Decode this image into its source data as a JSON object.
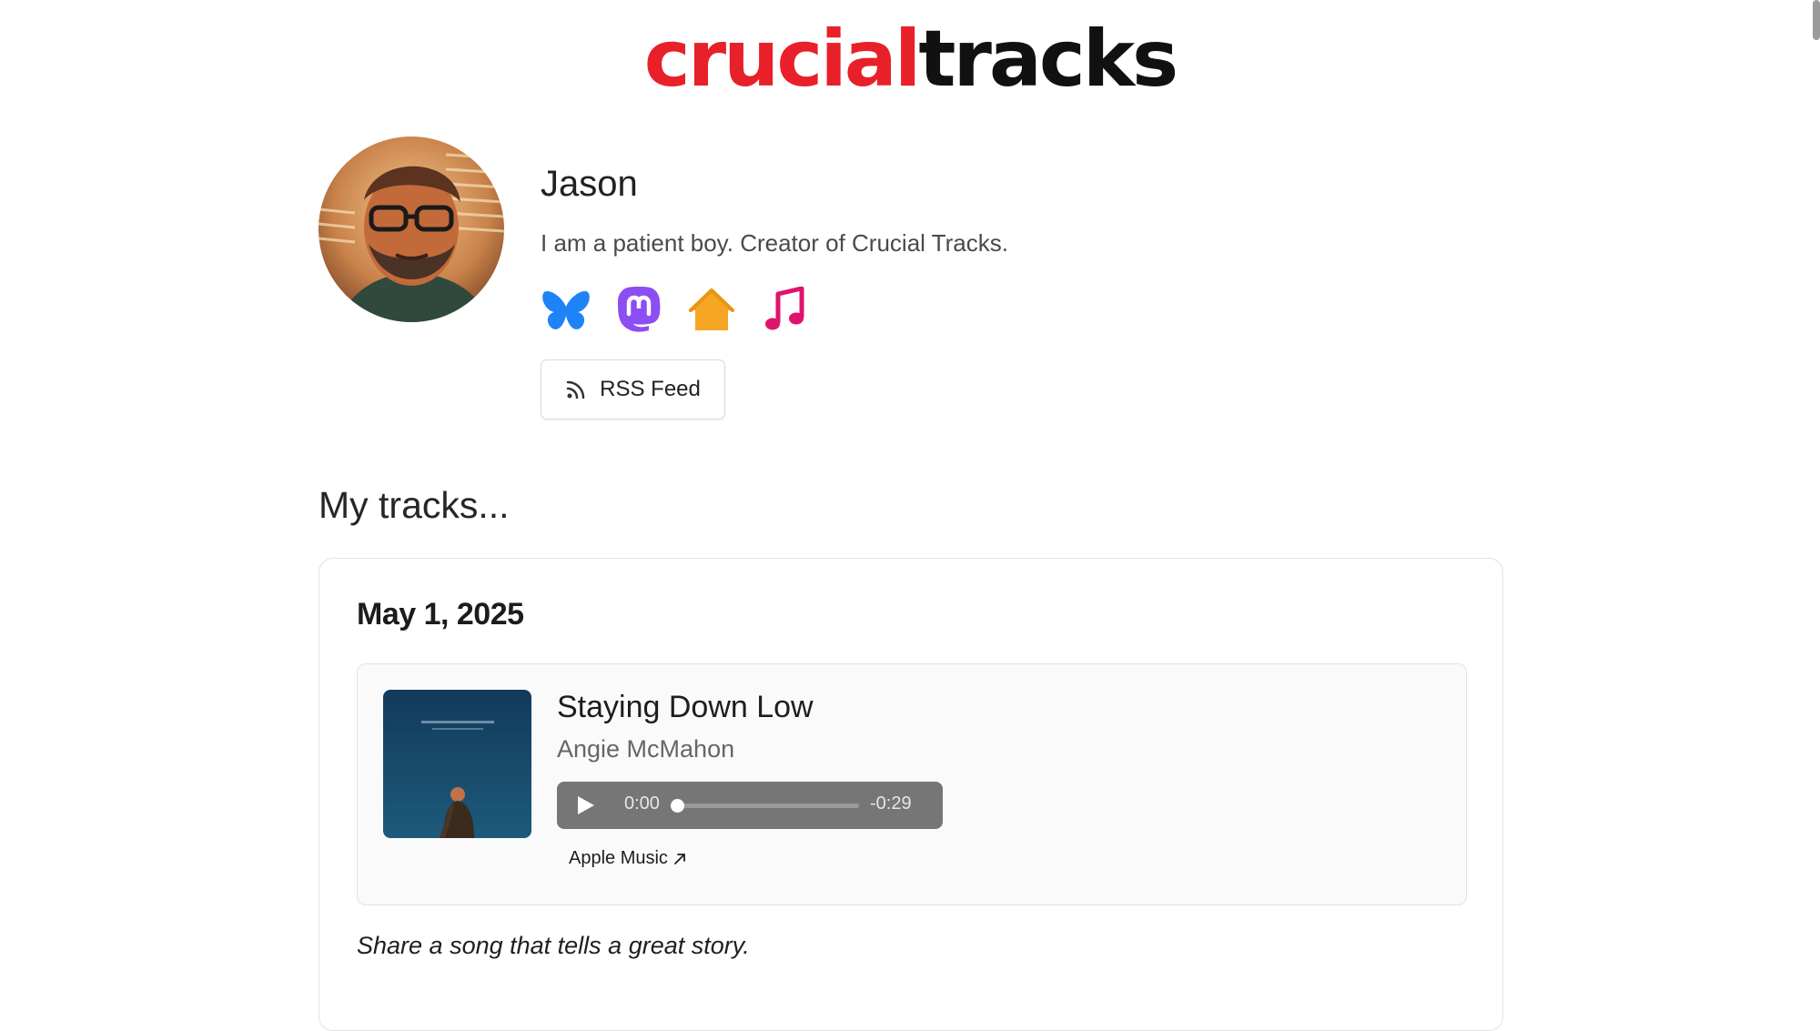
{
  "logo": {
    "part1": "crucial",
    "part2": "tracks",
    "color1": "#e8202a",
    "color2": "#111111"
  },
  "profile": {
    "name": "Jason",
    "bio": "I am a patient boy. Creator of Crucial Tracks.",
    "socials": [
      {
        "icon": "bluesky-butterfly-icon",
        "color": "#1e83f7"
      },
      {
        "icon": "mastodon-icon",
        "color": "#8c4ef2"
      },
      {
        "icon": "home-icon",
        "color": "#f5a623"
      },
      {
        "icon": "music-note-icon",
        "color": "#e0136c"
      }
    ],
    "rss_label": "RSS Feed"
  },
  "section_title": "My tracks...",
  "entry": {
    "date": "May 1, 2025",
    "track": {
      "title": "Staying Down Low",
      "artist": "Angie McMahon",
      "time_current": "0:00",
      "time_remaining": "-0:29",
      "progress": 0,
      "link_label": "Apple Music"
    },
    "prompt": "Share a song that tells a great story."
  }
}
